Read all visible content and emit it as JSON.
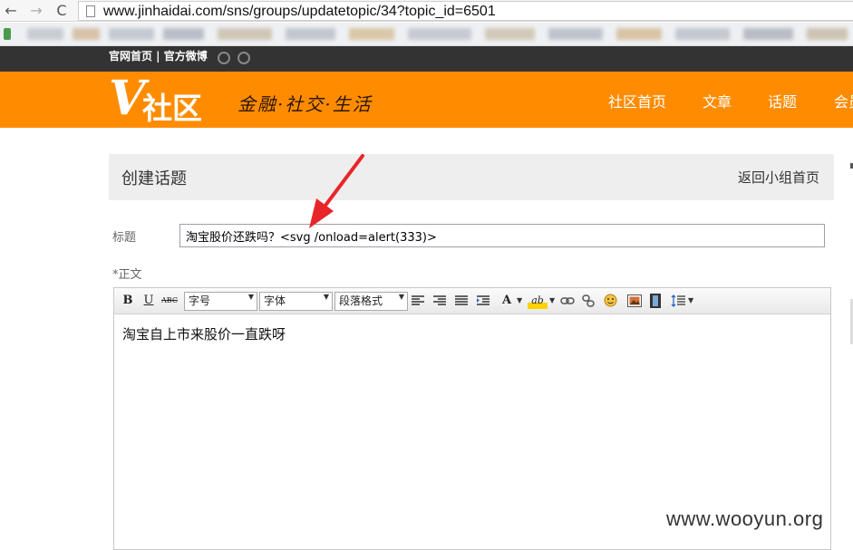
{
  "browser": {
    "url": "www.jinhaidai.com/sns/groups/updatetopic/34?topic_id=6501",
    "back_icon": "←",
    "forward_icon": "→",
    "reload_icon": "C"
  },
  "topbar": {
    "links": "官网首页 | 官方微博"
  },
  "header": {
    "logo_v": "V",
    "logo_text": "社区",
    "slogan": "金融·社交·生活",
    "nav": [
      "社区首页",
      "文章",
      "话题",
      "会员"
    ]
  },
  "panel": {
    "title": "创建话题",
    "back_link": "返回小组首页"
  },
  "form": {
    "title_label": "标题",
    "title_value": "淘宝股价还跌吗？<svg /onload=alert(333)>",
    "body_label": "*正文",
    "body_text": "淘宝自上市来股价一直跌呀"
  },
  "editor_toolbar": {
    "bold": "B",
    "underline": "U",
    "strike": "ABC",
    "font_size": "字号",
    "font_family": "字体",
    "paragraph": "段落格式",
    "font_color": "A",
    "highlight": "ab",
    "dropdown_arrow": "▼"
  },
  "watermark": "www.wooyun.org",
  "colors": {
    "brand_orange": "#ff8c00",
    "topbar": "#333333",
    "annotation_arrow": "#e8262a"
  }
}
